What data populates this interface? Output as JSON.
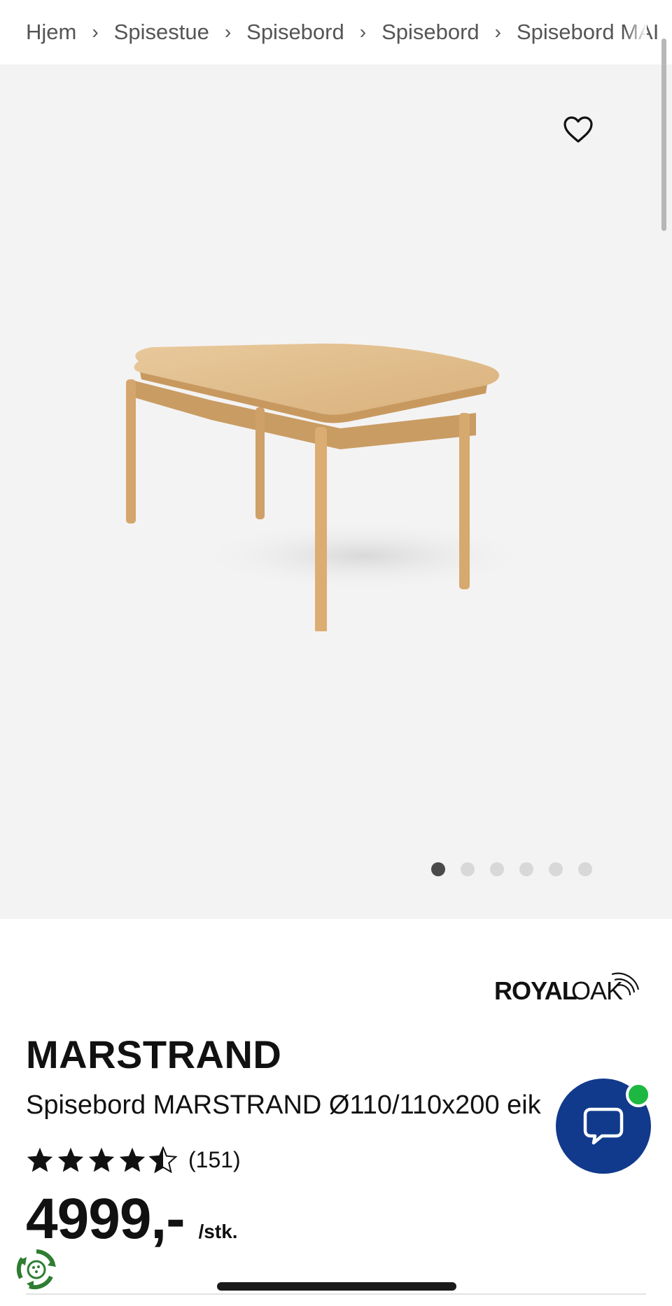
{
  "breadcrumb": {
    "items": [
      "Hjem",
      "Spisestue",
      "Spisebord",
      "Spisebord",
      "Spisebord MAI"
    ],
    "separator": "›"
  },
  "gallery": {
    "image_count": 6,
    "active_index": 0,
    "background": "#f4f3f3"
  },
  "icons": {
    "wishlist": "heart-outline-icon",
    "chat": "speech-bubble-icon",
    "badge": "recycle-sustainability-icon"
  },
  "product": {
    "brand": "ROYALOAK",
    "brand_parts": [
      "ROYAL",
      "OAK"
    ],
    "name": "MARSTRAND",
    "description": "Spisebord MARSTRAND Ø110/110x200 eik",
    "rating": 4.5,
    "review_count": "(151)",
    "price": "4999,-",
    "unit": "/stk."
  },
  "colors": {
    "chat_button": "#113a8c",
    "online_status": "#1db841",
    "badge_green": "#2e7d32"
  }
}
